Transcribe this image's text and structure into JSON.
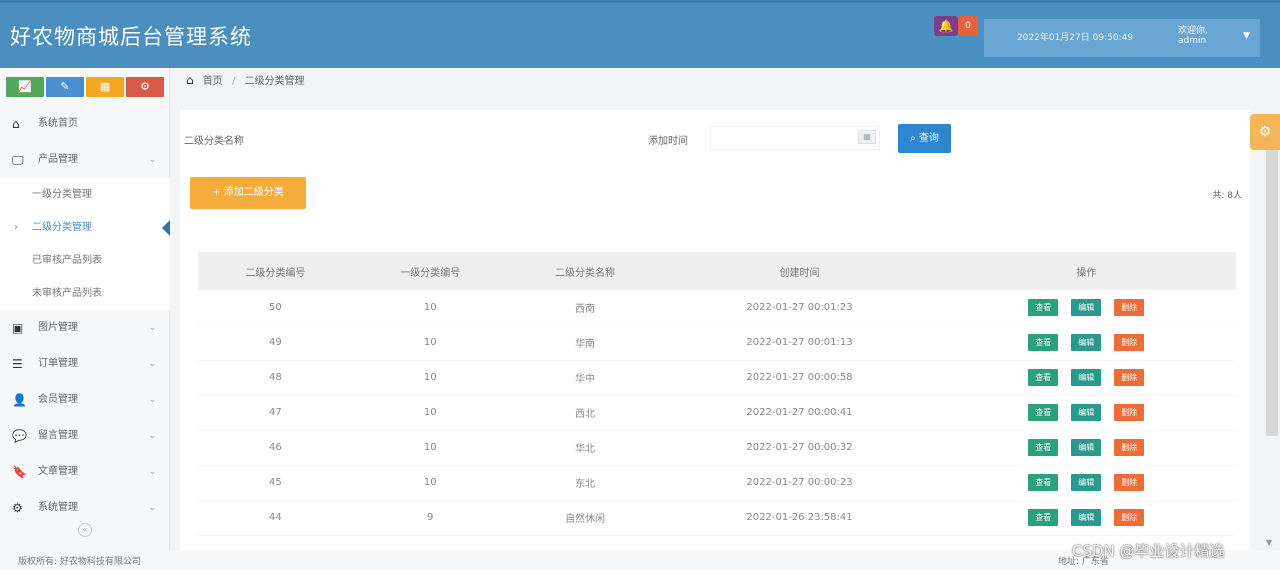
{
  "header": {
    "title": "好农物商城后台管理系统",
    "notification_count": "0",
    "datetime": "2022年01月27日 09:50:49",
    "user_greeting": "欢迎你,",
    "username": "admin"
  },
  "sidebar": {
    "shortcuts": [
      {
        "icon": "chart-icon",
        "glyph": "📈",
        "color": "#52a85a"
      },
      {
        "icon": "pencil-icon",
        "glyph": "✎",
        "color": "#4a8fd0"
      },
      {
        "icon": "users-icon",
        "glyph": "▦",
        "color": "#f5a623"
      },
      {
        "icon": "cogs-icon",
        "glyph": "⚙",
        "color": "#d65a4a"
      }
    ],
    "items": [
      {
        "label": "系统首页",
        "icon": "home-icon"
      },
      {
        "label": "产品管理",
        "icon": "desktop-icon",
        "expanded": true
      },
      {
        "label": "一级分类管理"
      },
      {
        "label": "二级分类管理",
        "active": true
      },
      {
        "label": "已审核产品列表"
      },
      {
        "label": "未审核产品列表"
      },
      {
        "label": "图片管理",
        "icon": "picture-icon"
      },
      {
        "label": "订单管理",
        "icon": "list-icon"
      },
      {
        "label": "会员管理",
        "icon": "user-icon"
      },
      {
        "label": "留言管理",
        "icon": "comments-icon"
      },
      {
        "label": "文章管理",
        "icon": "bookmark-icon"
      },
      {
        "label": "系统管理",
        "icon": "cogs-icon"
      }
    ]
  },
  "breadcrumb": {
    "home": "首页",
    "current": "二级分类管理"
  },
  "search": {
    "name_label": "二级分类名称",
    "name_placeholder": "",
    "time_label": "添加时间",
    "search_button": "查询"
  },
  "toolbar": {
    "add_button": "+ 添加二级分类",
    "total": "共: 8人"
  },
  "table": {
    "columns": [
      "二级分类编号",
      "一级分类编号",
      "二级分类名称",
      "创建时间",
      "操作"
    ],
    "rows": [
      [
        "50",
        "10",
        "西南",
        "2022-01-27 00:01:23"
      ],
      [
        "49",
        "10",
        "华南",
        "2022-01-27 00:01:13"
      ],
      [
        "48",
        "10",
        "华中",
        "2022-01-27 00:00:58"
      ],
      [
        "47",
        "10",
        "西北",
        "2022-01-27 00:00:41"
      ],
      [
        "46",
        "10",
        "华北",
        "2022-01-27 00:00:32"
      ],
      [
        "45",
        "10",
        "东北",
        "2022-01-27 00:00:23"
      ],
      [
        "44",
        "9",
        "自然休闲",
        "2022-01-26 23:58:41"
      ]
    ],
    "actions": [
      "查看",
      "编辑",
      "删除"
    ]
  },
  "footer": {
    "copyright": "版权所有:  好农物科技有限公司",
    "right_text": "地址: 广东省"
  },
  "watermark": "CSDN @毕业设计精选"
}
